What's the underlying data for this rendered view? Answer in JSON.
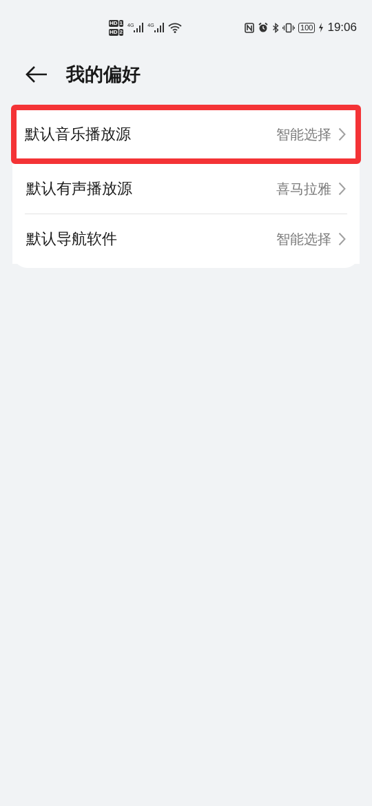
{
  "status_bar": {
    "sims": [
      {
        "label": "HD",
        "slot": "1"
      },
      {
        "label": "HD",
        "slot": "2"
      }
    ],
    "networks": [
      "4G",
      "4G"
    ],
    "battery": "100",
    "time": "19:06"
  },
  "header": {
    "title": "我的偏好"
  },
  "rows": [
    {
      "label": "默认音乐播放源",
      "value": "智能选择",
      "highlighted": true
    },
    {
      "label": "默认有声播放源",
      "value": "喜马拉雅",
      "highlighted": false
    },
    {
      "label": "默认导航软件",
      "value": "智能选择",
      "highlighted": false
    }
  ]
}
